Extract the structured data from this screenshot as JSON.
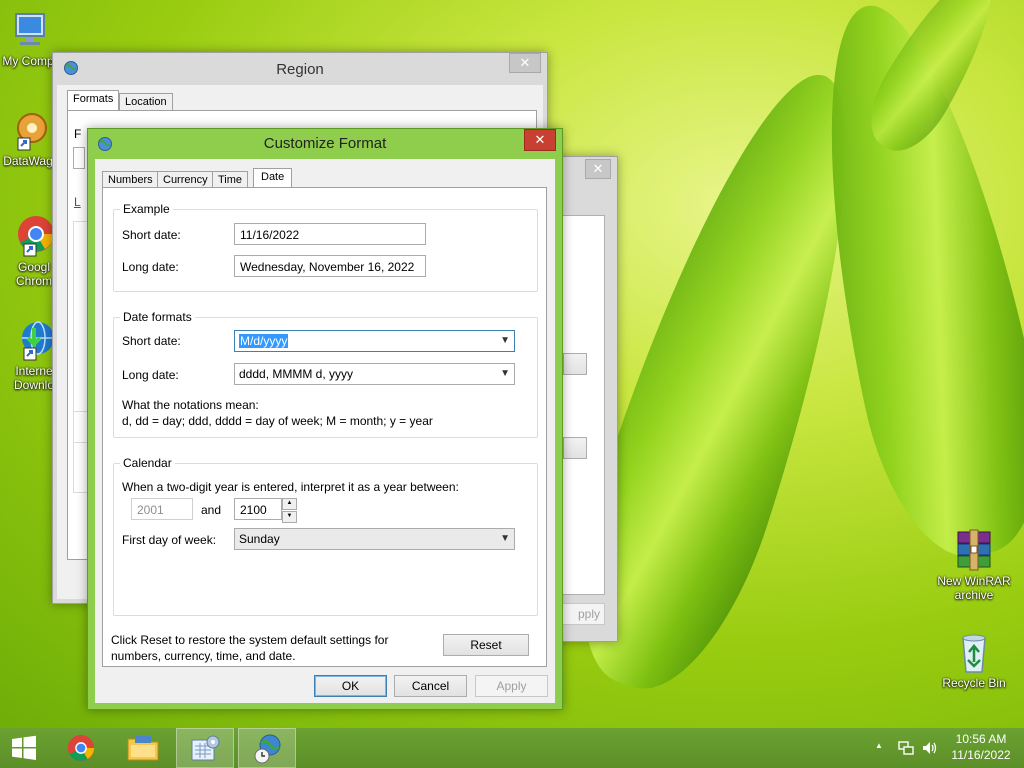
{
  "desktop": {
    "icons": [
      {
        "label": "My Comp",
        "icon": "computer-icon"
      },
      {
        "label": "DataWag",
        "icon": "datawag-icon"
      },
      {
        "label": "Googl",
        "label2": "Chrom",
        "icon": "chrome-icon"
      },
      {
        "label": "Interne",
        "label2": "Downlo",
        "icon": "internet-download-icon"
      },
      {
        "label": "New WinRAR",
        "label2": "archive",
        "icon": "winrar-icon"
      },
      {
        "label": "Recycle Bin",
        "icon": "recycle-bin-icon"
      }
    ]
  },
  "region_window": {
    "title": "Region",
    "close": "✕",
    "tabs": [
      "Formats",
      "Location"
    ],
    "partial_text": [
      "F",
      "L"
    ]
  },
  "back_window": {
    "close": "✕",
    "apply_partial": "pply"
  },
  "customize_format": {
    "title": "Customize Format",
    "close": "✕",
    "tabs": [
      "Numbers",
      "Currency",
      "Time",
      "Date"
    ],
    "active_tab": "Date",
    "example": {
      "legend": "Example",
      "short_label": "Short date:",
      "short_value": "11/16/2022",
      "long_label": "Long date:",
      "long_value": "Wednesday, November 16, 2022"
    },
    "date_formats": {
      "legend": "Date formats",
      "short_label": "Short date:",
      "short_value": "M/d/yyyy",
      "long_label": "Long date:",
      "long_value": "dddd, MMMM d, yyyy",
      "notation_title": "What the notations mean:",
      "notation_text": "d, dd = day;  ddd, dddd = day of week;  M = month;  y = year"
    },
    "calendar": {
      "legend": "Calendar",
      "two_digit_text": "When a two-digit year is entered, interpret it as a year between:",
      "from_year": "2001",
      "and_label": "and",
      "to_year": "2100",
      "first_day_label": "First day of week:",
      "first_day_value": "Sunday"
    },
    "reset_text_1": "Click Reset to restore the system default settings for",
    "reset_text_2": "numbers, currency, time, and date.",
    "reset_label": "Reset",
    "ok_label": "OK",
    "cancel_label": "Cancel",
    "apply_label": "Apply"
  },
  "taskbar": {
    "time": "10:56 AM",
    "date": "11/16/2022",
    "tray_up": "▲"
  }
}
